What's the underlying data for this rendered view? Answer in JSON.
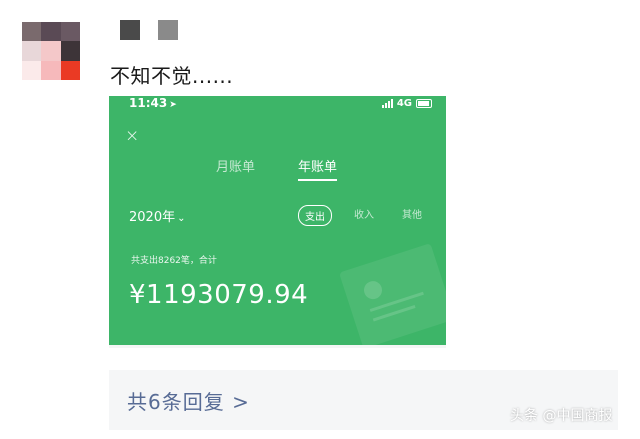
{
  "comment": {
    "text": "不知不觉......"
  },
  "screenshot": {
    "status_bar": {
      "time": "11:43",
      "location_arrow": "➤",
      "network": "4G",
      "signal_icon": "signal-icon",
      "battery_icon": "battery-icon"
    },
    "close_icon": "×",
    "tabs": [
      {
        "label": "月账单",
        "active": false
      },
      {
        "label": "年账单",
        "active": true
      }
    ],
    "year_selector": {
      "label": "2020年",
      "chevron": "⌄"
    },
    "filters": [
      {
        "label": "支出",
        "active": true
      },
      {
        "label": "收入",
        "active": false
      },
      {
        "label": "其他",
        "active": false
      }
    ],
    "summary": "共支出8262笔，合计",
    "amount": "¥1193079.94",
    "bg_color": "#3db568"
  },
  "replies": {
    "label": "共6条回复 >"
  },
  "watermark": {
    "text": "头条 @中国商报"
  },
  "colors": {
    "link": "#576b95",
    "reply_bg": "#f5f6f7"
  }
}
